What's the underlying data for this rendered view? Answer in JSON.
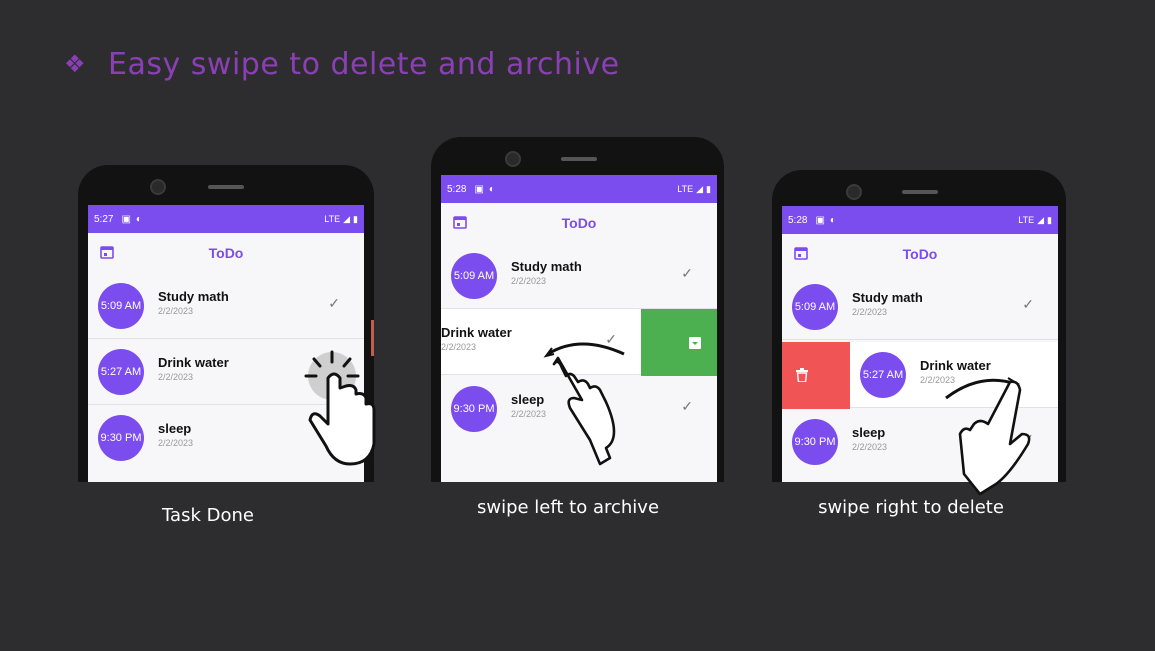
{
  "slide": {
    "bullet": "❖",
    "title": "Easy swipe to delete and archive",
    "captions": [
      "Task Done",
      "swipe left to archive",
      "swipe right to delete"
    ]
  },
  "app": {
    "title": "ToDo",
    "accent_color": "#7c4dee",
    "archive_color": "#4caf50",
    "delete_color": "#f05454"
  },
  "phones": [
    {
      "status_time": "5:27",
      "network": "LTE",
      "tasks": [
        {
          "time": "5:09 AM",
          "name": "Study math",
          "date": "2/2/2023"
        },
        {
          "time": "5:27 AM",
          "name": "Drink water",
          "date": "2/2/2023"
        },
        {
          "time": "9:30 PM",
          "name": "sleep",
          "date": "2/2/2023"
        }
      ]
    },
    {
      "status_time": "5:28",
      "network": "LTE",
      "tasks": [
        {
          "time": "5:09 AM",
          "name": "Study math",
          "date": "2/2/2023"
        },
        {
          "time": "",
          "name": "Drink water",
          "date": "2/2/2023"
        },
        {
          "time": "9:30 PM",
          "name": "sleep",
          "date": "2/2/2023"
        }
      ]
    },
    {
      "status_time": "5:28",
      "network": "LTE",
      "tasks": [
        {
          "time": "5:09 AM",
          "name": "Study math",
          "date": "2/2/2023"
        },
        {
          "time": "5:27 AM",
          "name": "Drink water",
          "date": "2/2/2023"
        },
        {
          "time": "9:30 PM",
          "name": "sleep",
          "date": "2/2/2023"
        }
      ]
    }
  ],
  "icons": {
    "check": "check-icon",
    "calendar": "calendar-icon",
    "archive": "archive-icon",
    "delete": "trash-icon",
    "hand": "hand-pointer-icon"
  }
}
